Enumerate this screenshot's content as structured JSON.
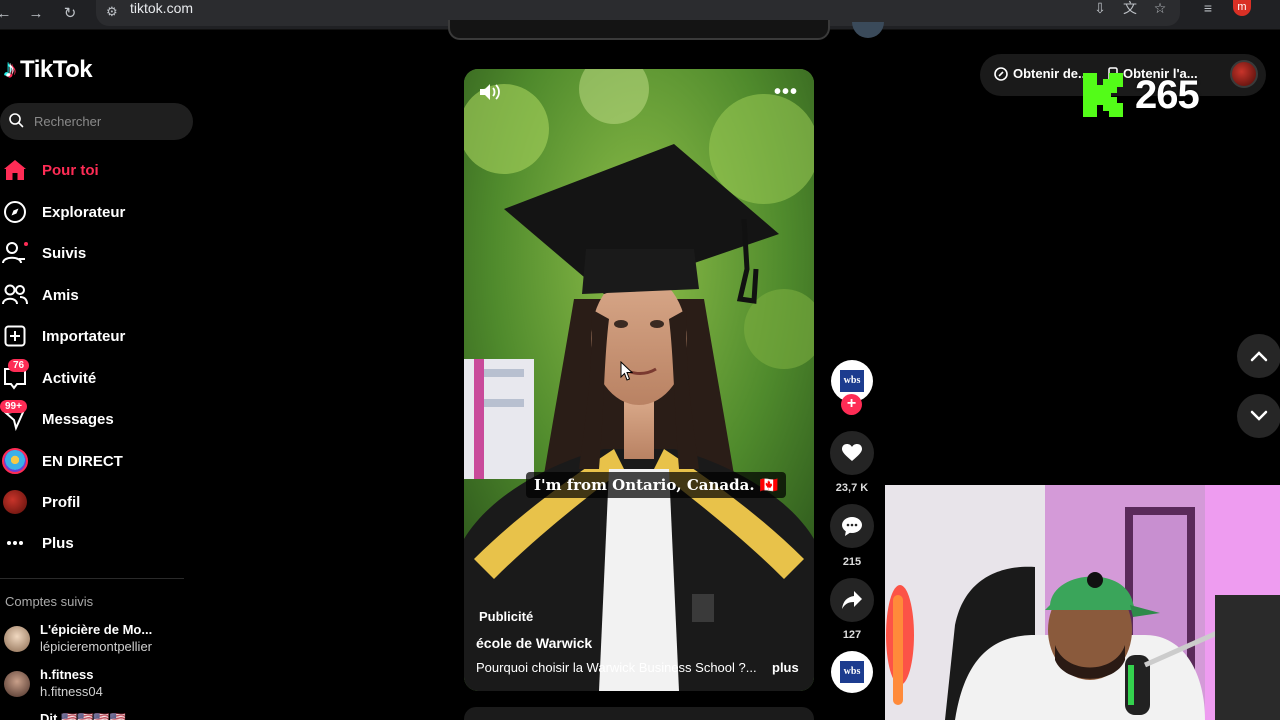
{
  "browser": {
    "url": "tiktok.com",
    "profile_initial": "m"
  },
  "sidebar": {
    "logo_text": "TikTok",
    "search_placeholder": "Rechercher",
    "items": [
      {
        "label": "Pour toi",
        "icon": "home-icon",
        "active": true
      },
      {
        "label": "Explorateur",
        "icon": "compass-icon"
      },
      {
        "label": "Suivis",
        "icon": "following-icon"
      },
      {
        "label": "Amis",
        "icon": "friends-icon"
      },
      {
        "label": "Importateur",
        "icon": "upload-icon"
      },
      {
        "label": "Activité",
        "icon": "activity-icon",
        "badge": "76"
      },
      {
        "label": "Messages",
        "icon": "messages-icon",
        "badge": "99+"
      },
      {
        "label": "EN DIRECT",
        "icon": "live-icon"
      },
      {
        "label": "Profil",
        "icon": "profile-avatar"
      },
      {
        "label": "Plus",
        "icon": "more-icon"
      }
    ],
    "followed_title": "Comptes suivis",
    "followed_accounts": [
      {
        "name": "L'épicière de Mo...",
        "handle": "lépicieremontpellier"
      },
      {
        "name": "h.fitness",
        "handle": "h.fitness04"
      },
      {
        "name": "Dit 🇺🇸🇺🇸🇺🇸🇺🇸",
        "handle": ""
      }
    ]
  },
  "video": {
    "caption": "I'm from Ontario, Canada. 🇨🇦",
    "ad_label": "Publicité",
    "author": "école de Warwick",
    "description": "Pourquoi choisir la Warwick Business School ?...",
    "more_label": "plus"
  },
  "actions": {
    "avatar_text": "wbs",
    "likes": "23,7 K",
    "comments": "215",
    "shares": "127"
  },
  "top_right": {
    "button1": "Obtenir de...",
    "button2": "Obtenir l'a..."
  },
  "overlay": {
    "kick_count": "265"
  },
  "colors": {
    "accent": "#fe2c55",
    "kick_green": "#53fc18"
  }
}
